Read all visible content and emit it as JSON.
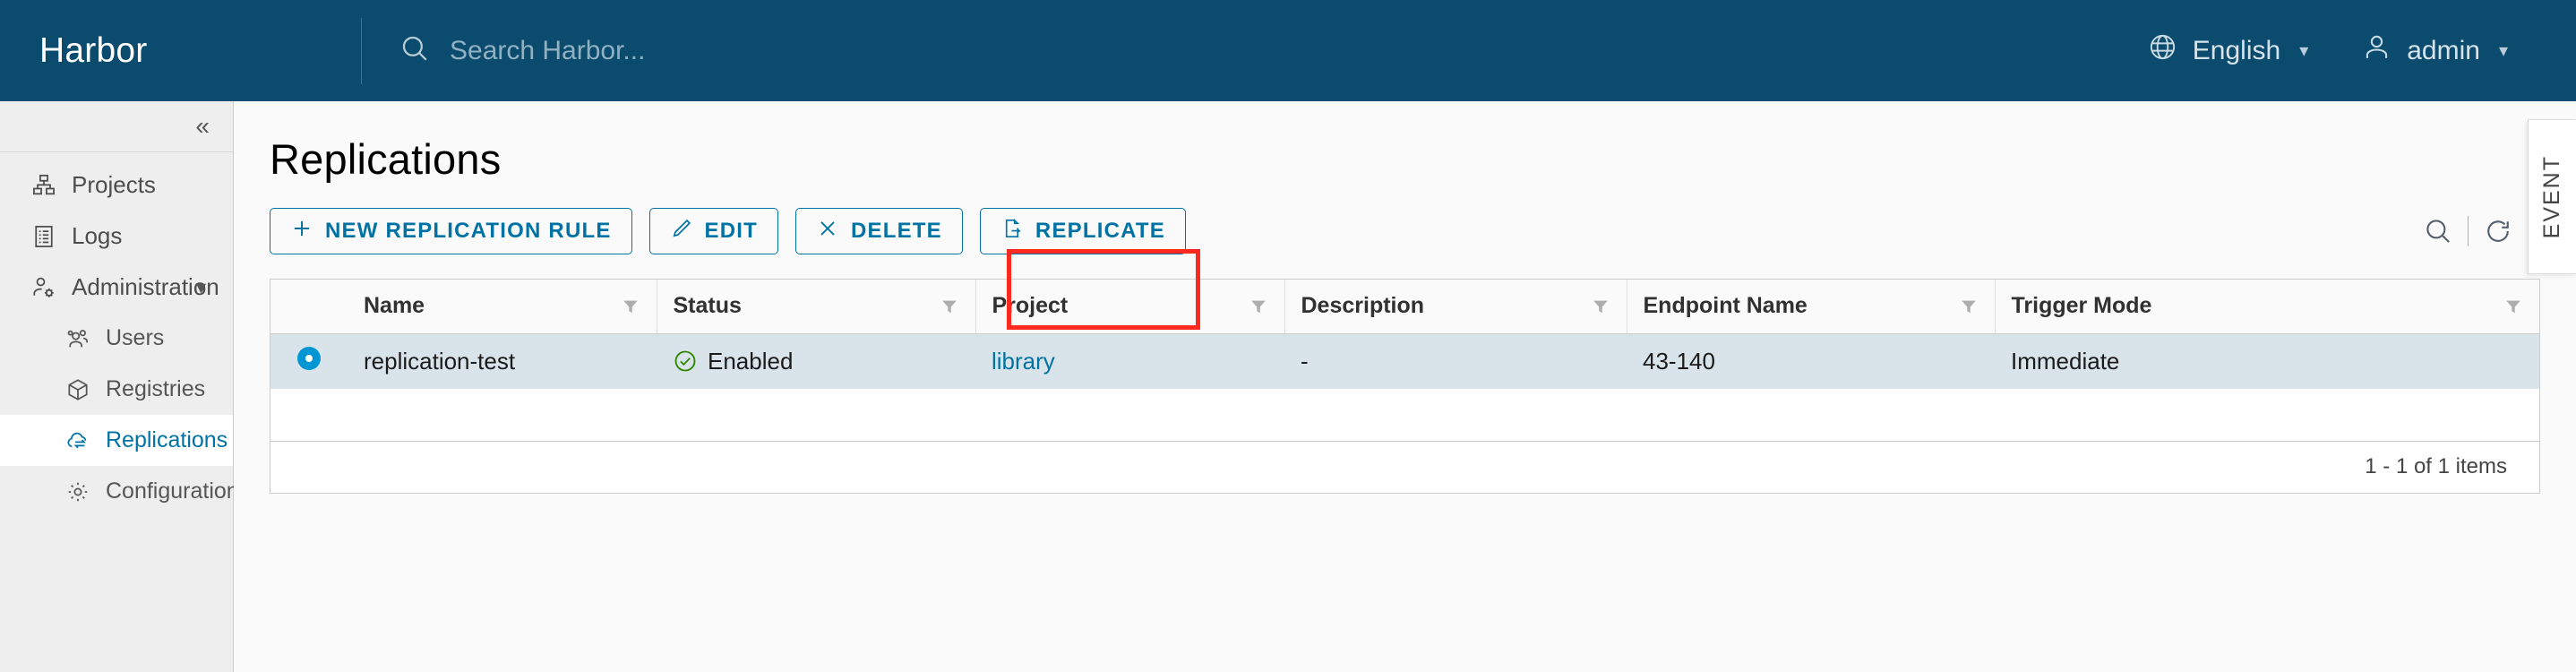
{
  "header": {
    "brand": "Harbor",
    "search_placeholder": "Search Harbor...",
    "search_value": "",
    "language": "English",
    "user": "admin"
  },
  "sidebar": {
    "items": [
      {
        "label": "Projects",
        "icon": "projects-icon",
        "level": "top",
        "active": false
      },
      {
        "label": "Logs",
        "icon": "logs-icon",
        "level": "top",
        "active": false
      },
      {
        "label": "Administration",
        "icon": "administration-icon",
        "level": "top",
        "active": false,
        "expanded": true
      },
      {
        "label": "Users",
        "icon": "users-icon",
        "level": "sub",
        "active": false
      },
      {
        "label": "Registries",
        "icon": "registries-icon",
        "level": "sub",
        "active": false
      },
      {
        "label": "Replications",
        "icon": "replications-icon",
        "level": "sub",
        "active": true
      },
      {
        "label": "Configuration",
        "icon": "configuration-icon",
        "level": "sub",
        "active": false
      }
    ]
  },
  "main": {
    "title": "Replications",
    "toolbar": {
      "new_rule": "NEW REPLICATION RULE",
      "edit": "EDIT",
      "delete": "DELETE",
      "replicate": "REPLICATE",
      "search_icon": "search-icon",
      "refresh_icon": "refresh-icon"
    },
    "table": {
      "columns": [
        "Name",
        "Status",
        "Project",
        "Description",
        "Endpoint Name",
        "Trigger Mode"
      ],
      "rows": [
        {
          "selected": true,
          "name": "replication-test",
          "status": "Enabled",
          "project": "library",
          "description": "-",
          "endpoint_name": "43-140",
          "trigger_mode": "Immediate"
        }
      ],
      "pagination": "1 - 1 of 1 items"
    }
  },
  "event_tab": {
    "label": "EVENT"
  },
  "colors": {
    "header_bg": "#0a4b6e",
    "accent": "#0072a3",
    "selected_row": "#d9e4ea",
    "status_ok": "#318700",
    "annotation": "#ff2a1f"
  }
}
